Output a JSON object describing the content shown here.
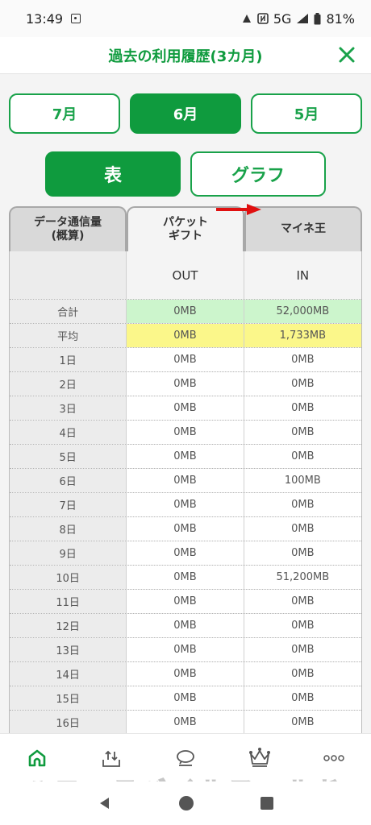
{
  "status": {
    "time": "13:49",
    "network": "5G",
    "battery": "81%"
  },
  "header": {
    "title": "過去の利用履歴(3カ月)"
  },
  "months": [
    "7月",
    "6月",
    "5月"
  ],
  "views": [
    "表",
    "グラフ"
  ],
  "tabs": [
    "データ通信量\n(概算)",
    "パケット\nギフト",
    "マイネ王"
  ],
  "table": {
    "head": {
      "out": "OUT",
      "in": "IN"
    },
    "total": {
      "label": "合計",
      "out": "0MB",
      "in": "52,000MB"
    },
    "average": {
      "label": "平均",
      "out": "0MB",
      "in": "1,733MB"
    },
    "days": [
      {
        "label": "1日",
        "out": "0MB",
        "in": "0MB"
      },
      {
        "label": "2日",
        "out": "0MB",
        "in": "0MB"
      },
      {
        "label": "3日",
        "out": "0MB",
        "in": "0MB"
      },
      {
        "label": "4日",
        "out": "0MB",
        "in": "0MB"
      },
      {
        "label": "5日",
        "out": "0MB",
        "in": "0MB"
      },
      {
        "label": "6日",
        "out": "0MB",
        "in": "100MB"
      },
      {
        "label": "7日",
        "out": "0MB",
        "in": "0MB"
      },
      {
        "label": "8日",
        "out": "0MB",
        "in": "0MB"
      },
      {
        "label": "9日",
        "out": "0MB",
        "in": "0MB"
      },
      {
        "label": "10日",
        "out": "0MB",
        "in": "51,200MB"
      },
      {
        "label": "11日",
        "out": "0MB",
        "in": "0MB"
      },
      {
        "label": "12日",
        "out": "0MB",
        "in": "0MB"
      },
      {
        "label": "13日",
        "out": "0MB",
        "in": "0MB"
      },
      {
        "label": "14日",
        "out": "0MB",
        "in": "0MB"
      },
      {
        "label": "15日",
        "out": "0MB",
        "in": "0MB"
      },
      {
        "label": "16日",
        "out": "0MB",
        "in": "0MB"
      }
    ]
  },
  "watermark": "ハローモバイルワールド",
  "colors": {
    "brand_green": "#0f9b3e",
    "total_row": "#ccf5cc",
    "average_row": "#fbf78a",
    "arrow": "#e01010"
  },
  "icons": {
    "bottom_nav": [
      "home-icon",
      "upload-tray-icon",
      "chat-bubble-icon",
      "crown-icon",
      "more-icon"
    ]
  }
}
